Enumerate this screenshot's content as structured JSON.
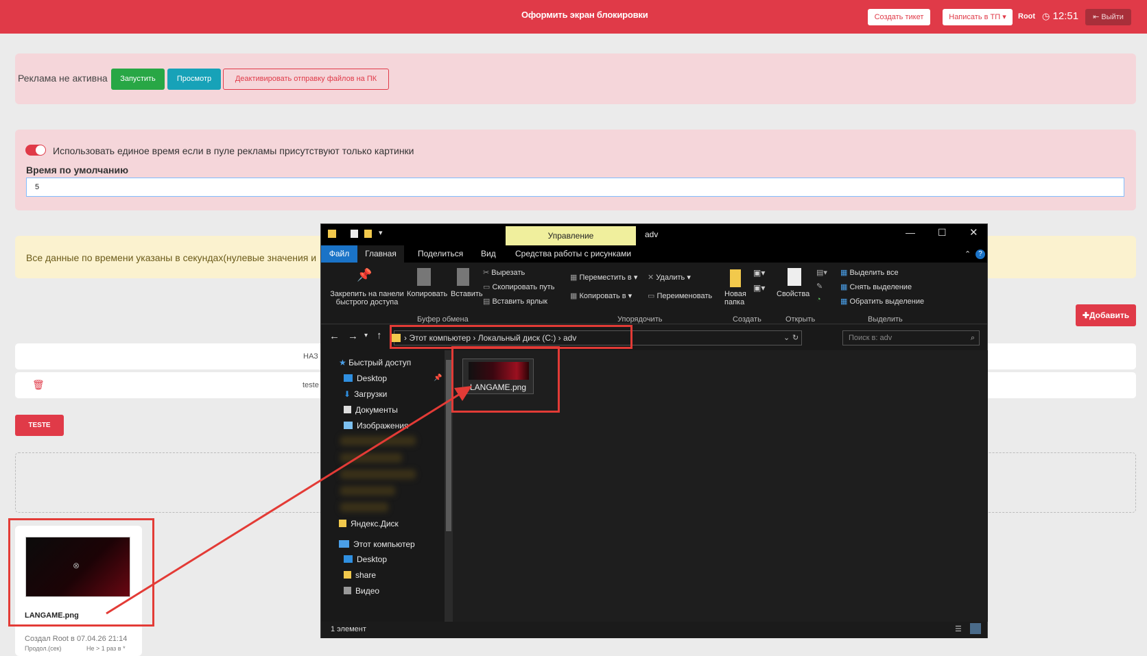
{
  "topbar": {
    "title": "Оформить экран блокировки",
    "ticket_btn": "Создать тикет",
    "support_btn": "Написать в ТП",
    "user": "Root",
    "clock_icon": "clock-icon",
    "time": "12:51",
    "logout": "Выйти"
  },
  "ad_status": {
    "label": "Реклама не активна",
    "start_btn": "Запустить",
    "preview_btn": "Просмотр",
    "deactivate_btn": "Деактивировать отправку файлов на ПК"
  },
  "settings": {
    "toggle_label": "Использовать единое время если в пуле рекламы присутствуют только картинки",
    "default_time_label": "Время по умолчанию",
    "default_time_value": "5"
  },
  "info_note": "Все данные по времени указаны в секундах(нулевые значения и",
  "add_btn": "Добавить",
  "table": {
    "header_fragment": "НАЗ",
    "row_fragment": "teste"
  },
  "teste_btn": "TESTE",
  "thumb_card": {
    "filename": "LANGAME.png",
    "created": "Создал Root в 07.04.26 21:14",
    "duration_label": "Продол.(сек)",
    "duration_value": "Не > 1 раз в *"
  },
  "explorer": {
    "window_title": "adv",
    "manage_tab": "Управление",
    "tabs": [
      "Файл",
      "Главная",
      "Поделиться",
      "Вид",
      "Средства работы с рисунками"
    ],
    "ribbon": {
      "pin": "Закрепить на панели быстрого доступа",
      "copy": "Копировать",
      "paste": "Вставить",
      "cut": "Вырезать",
      "copy_path": "Скопировать путь",
      "paste_shortcut": "Вставить ярлык",
      "group_clipboard": "Буфер обмена",
      "move_to": "Переместить в",
      "copy_to": "Копировать в",
      "delete": "Удалить",
      "rename": "Переименовать",
      "group_organize": "Упорядочить",
      "new_folder": "Новая папка",
      "group_create": "Создать",
      "properties": "Свойства",
      "group_open": "Открыть",
      "select_all": "Выделить все",
      "deselect": "Снять выделение",
      "invert": "Обратить выделение",
      "group_select": "Выделить"
    },
    "path": [
      "Этот компьютер",
      "Локальный диск (C:)",
      "adv"
    ],
    "search_placeholder": "Поиск в: adv",
    "nav": {
      "quick_access": "Быстрый доступ",
      "desktop": "Desktop",
      "downloads": "Загрузки",
      "documents": "Документы",
      "pictures": "Изображения",
      "yandex": "Яндекс.Диск",
      "this_pc": "Этот компьютер",
      "pc_desktop": "Desktop",
      "share": "share",
      "video": "Видео"
    },
    "file": "LANGAME.png",
    "status": "1 элемент"
  },
  "colors": {
    "brand_red": "#e03a48",
    "green": "#28a745",
    "teal": "#17a2b8",
    "annotation_red": "#e33b36"
  }
}
